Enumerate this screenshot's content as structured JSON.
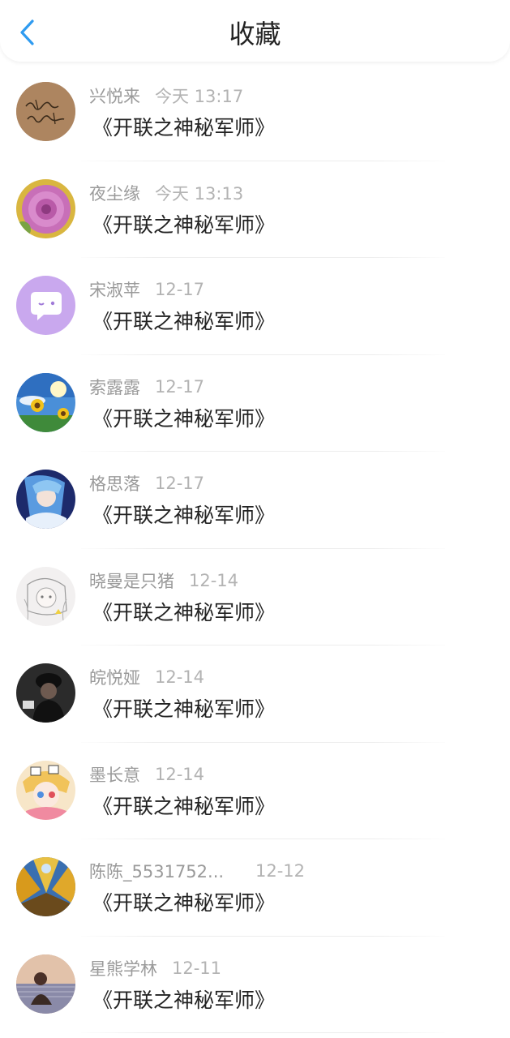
{
  "header": {
    "title": "收藏",
    "back_icon": "chevron-left-icon",
    "accent_color": "#2f9bf0"
  },
  "items": [
    {
      "name": "兴悦来",
      "time": "今天 13:17",
      "content": "《开联之神秘军师》",
      "avatar": "handwriting-avatar"
    },
    {
      "name": "夜尘缘",
      "time": "今天 13:13",
      "content": "《开联之神秘军师》",
      "avatar": "flower-avatar"
    },
    {
      "name": "宋淑苹",
      "time": "12-17",
      "content": "《开联之神秘军师》",
      "avatar": "chat-bubble-avatar"
    },
    {
      "name": "索露露",
      "time": "12-17",
      "content": "《开联之神秘军师》",
      "avatar": "sunflower-avatar"
    },
    {
      "name": "格思落",
      "time": "12-17",
      "content": "《开联之神秘军师》",
      "avatar": "anime-blue-avatar"
    },
    {
      "name": "晓曼是只猪",
      "time": "12-14",
      "content": "《开联之神秘军师》",
      "avatar": "sketch-avatar"
    },
    {
      "name": "皖悦娅",
      "time": "12-14",
      "content": "《开联之神秘军师》",
      "avatar": "dark-cap-avatar"
    },
    {
      "name": "墨长意",
      "time": "12-14",
      "content": "《开联之神秘军师》",
      "avatar": "anime-colorful-avatar"
    },
    {
      "name": "陈陈_5531752...",
      "time": "12-12",
      "content": "《开联之神秘军师》",
      "avatar": "autumn-trees-avatar"
    },
    {
      "name": "星熊学林",
      "time": "12-11",
      "content": "《开联之神秘军师》",
      "avatar": "sunset-avatar"
    }
  ]
}
